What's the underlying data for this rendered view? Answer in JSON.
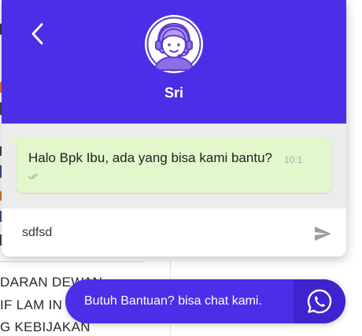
{
  "agent": {
    "name": "Sri"
  },
  "header": {
    "back_icon": "chevron-left-icon",
    "avatar_icon": "support-agent-icon",
    "color": "#4a2ee8"
  },
  "message": {
    "text": "Halo Bpk Ibu, ada yang bisa kami bantu?",
    "time": "10:1",
    "status_icon": "double-check-icon",
    "bubble_color": "#e2f7cb"
  },
  "composer": {
    "value": "sdfsd",
    "send_icon": "send-icon"
  },
  "cta": {
    "label": "Butuh Bantuan? bisa chat kami.",
    "icon": "whatsapp-icon"
  },
  "background": {
    "lines": [
      "DARAN DEWAN",
      "IF LAM IN",
      "G KEBIJAKAN"
    ]
  }
}
